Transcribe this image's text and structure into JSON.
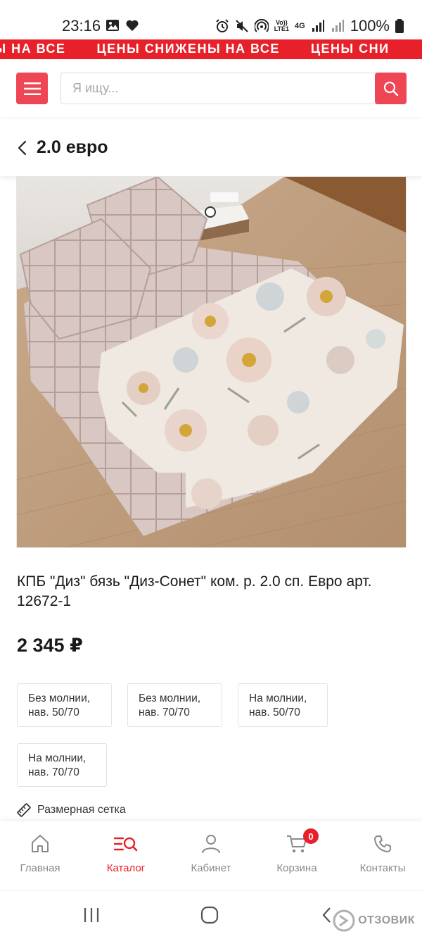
{
  "status_bar": {
    "time": "23:16",
    "battery": "100%",
    "network_label": "LTE1",
    "network_gen": "4G",
    "icons": [
      "image-icon",
      "heart-icon",
      "alarm-icon",
      "mute-icon",
      "hotspot-icon",
      "volte-icon",
      "signal-icon",
      "signal-icon",
      "battery-icon"
    ]
  },
  "promo": {
    "text": "ЦЕНЫ СНИЖЕНЫ НА ВСЕ",
    "text_partial_left": "НЫ НА ВСЕ",
    "text_partial_right": "ЦЕНЫ СНИ",
    "color": "#e8202a"
  },
  "header": {
    "menu_icon": "hamburger-icon",
    "search_placeholder": "Я ищу...",
    "search_icon": "search-icon",
    "accent_color": "#ef4656"
  },
  "page": {
    "title": "2.0 евро",
    "back_icon": "chevron-left-icon"
  },
  "product": {
    "name": "КПБ \"Диз\" бязь \"Диз-Сонет\" ком. р. 2.0 сп. Евро арт. 12672-1",
    "price": "2 345 ₽",
    "options": [
      {
        "line1": "Без молнии,",
        "line2": "нав. 50/70"
      },
      {
        "line1": "Без молнии,",
        "line2": "нав. 70/70"
      },
      {
        "line1": "На молнии,",
        "line2": "нав. 50/70"
      },
      {
        "line1": "На молнии,",
        "line2": "нав. 70/70"
      }
    ],
    "size_chart_label": "Размерная сетка",
    "size_chart_icon": "ruler-icon"
  },
  "bottom_nav": {
    "items": [
      {
        "label": "Главная",
        "icon": "home-icon"
      },
      {
        "label": "Каталог",
        "icon": "catalog-search-icon",
        "active": true
      },
      {
        "label": "Кабинет",
        "icon": "user-icon"
      },
      {
        "label": "Корзина",
        "icon": "cart-icon",
        "badge": "0"
      },
      {
        "label": "Контакты",
        "icon": "phone-icon"
      }
    ]
  },
  "system_nav": {
    "watermark": "ОТЗОВИК"
  }
}
